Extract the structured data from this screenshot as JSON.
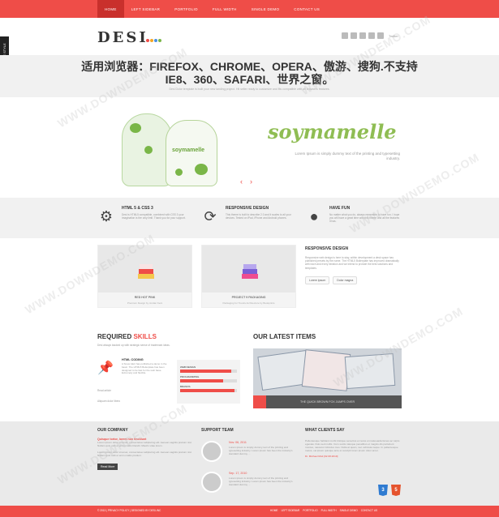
{
  "nav": {
    "items": [
      "HOME",
      "LEFT SIDEBAR",
      "PORTFOLIO",
      "FULL WIDTH",
      "SINGLE DEMO",
      "CONTACT US"
    ],
    "active": 0
  },
  "sidetab": "THEME STYLE",
  "logo": {
    "text": "DESI",
    "dot_colors": [
      "#ef4d48",
      "#f5a623",
      "#4a90e2",
      "#7ab648"
    ]
  },
  "social": {
    "label": "Twitter"
  },
  "notice": {
    "line1": "适用浏览器：FIREFOX、CHROME、OPERA、傲游、搜狗.不支持",
    "line2": "IE8、360、SAFARI、世界之窗。",
    "sub": "Desi Dolor template is built your new landing project. Hit seller ready to customize and fits compatible with all browsers features."
  },
  "hero": {
    "bag_label": "soymamelle",
    "brand": "soymamelle",
    "tagline": "Lorem Ipsum is simply dummy text of the printing and typesetting industry."
  },
  "features": [
    {
      "icon": "gears-icon",
      "title": "HTML 5 & CSS 3",
      "desc": "Desi is HTML5 compatible, combined with CSS 3 your imagination is the only limit. Thank you for your support."
    },
    {
      "icon": "refresh-icon",
      "title": "RESPONSIVE DESIGN",
      "desc": "This theme is built to describe 2.0 and it scales to all your devices. Tested on iPad, iPhone and Android phones."
    },
    {
      "icon": "user-icon",
      "title": "HAVE FUN",
      "desc": "No matter what you do, always remember to have fun. I hope you will have a great time with this theme and all the features it has."
    }
  ],
  "cards": [
    {
      "title": "RED HOT PINK",
      "sub": "Premium Design by Jordan Kent"
    },
    {
      "title": "PROJECT 9 PACKAGING",
      "sub": "Packaging for Trends Architecture by Bookprints"
    }
  ],
  "responsive": {
    "title": "RESPONSIVE DESIGN",
    "desc": "Responsive web design is here to stay, within development a desk space has published presets by the name. The HTML5 Boilerplate has improved dramatically with each and every iteration and we intend to provide the best solutions and templates.",
    "btn1": "Lorem ipsum",
    "btn2": "Dolor magna"
  },
  "skills": {
    "heading_pre": "REQUIRED",
    "heading_red": "SKILLS",
    "intro": "Desi always backed up with strategic sense of trademark ideas.",
    "item_title": "HTML CODING",
    "item_desc": "A Snow Alert has published a demo in the basic. The HTML5 Boilerplate has been designed to be fast for the web base. Extremely and flexible.",
    "readmore": "Read article",
    "more": "Aliquam dolor libero",
    "bars": [
      {
        "label": "WEB DESIGN",
        "value": 90
      },
      {
        "label": "PROGRAMMING",
        "value": 75
      },
      {
        "label": "BRANDS",
        "value": 95
      }
    ]
  },
  "latest": {
    "heading": "OUR LATEST ITEMS",
    "caption": "THE QUICK BROWN FOX JUMPS OVER"
  },
  "footer": {
    "company": {
      "title": "OUR COMPANY",
      "lead": "Quisque tortor, lorem non tincidunt",
      "desc1": "Lorem ipsum dolor sit amet, consectetuer adipiscing elit. Aenean sagittis pretium nisl. Nullam quis velit et enim mattis blandit. Mauris vitae lorem.",
      "desc2": "Lorem ipsum dolor sit amet, consectetuer adipiscing elit. Aenean sagittis pretium nisl. Nullam quis velit et enim mattis pretium.",
      "btn": "Read More"
    },
    "support": {
      "title": "SUPPORT TEAM",
      "items": [
        {
          "date": "Nov. 06, 2011",
          "desc": "Lorem ipsum is simply dummy text of the printing and typesetting industry. Lorem ipsum has been the industry's standard dummy ..."
        },
        {
          "date": "Sep. 17, 2010",
          "desc": "Lorem ipsum is simply dummy text of the printing and typesetting industry. Lorem ipsum has been the industry's standard dummy ..."
        }
      ]
    },
    "clients": {
      "title": "WHAT CLIENTS SAY",
      "quote": "Pellentesque habitant morbi tristique senectus et netus et malesuada fames ac turpis egestas. Duis sed mollis. Cum sociis natoque penatibus et magnis dis parturient montes, nascetur ridiculus mus. Nulla at quam, nec vehicula neque. In pellentesque metus, vel ipsum quisque ante et suscipit lorem ipsum dolor amet.",
      "name": "Dr. Michael Mott [02.08.2010]"
    },
    "badges": [
      {
        "label": "3",
        "color": "#2f7bd1"
      },
      {
        "label": "5",
        "color": "#e5532d"
      }
    ]
  },
  "bottom": {
    "copyright": "© 2013 | PRIVACY POLICY | DESIGNED BY DESI-INC",
    "nav": [
      "HOME",
      "LEFT SIDEBAR",
      "PORTFOLIO",
      "FULL WIDTH",
      "SINGLE DEMO",
      "CONTACT US"
    ]
  },
  "watermark": "WWW.DOWNDEMO.COM"
}
